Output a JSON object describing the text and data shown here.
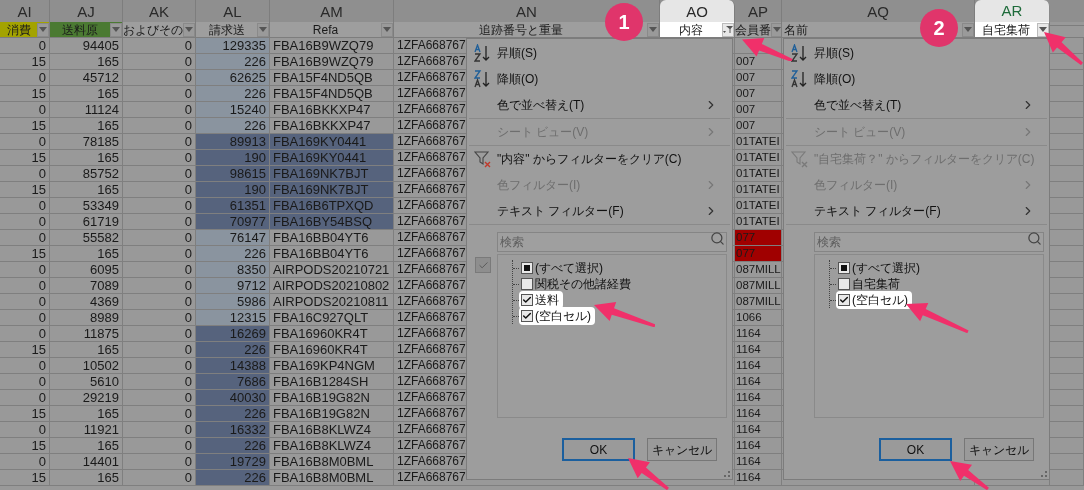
{
  "columns": [
    {
      "letter": "AI",
      "label": "消費",
      "color": "#a3a300",
      "selected": false,
      "spotlighted": false,
      "filtered": false
    },
    {
      "letter": "AJ",
      "label": "送料原",
      "color": "#4b7a32",
      "selected": false,
      "spotlighted": false,
      "filtered": false
    },
    {
      "letter": "AK",
      "label": "およびその",
      "selected": false,
      "spotlighted": false,
      "filtered": false
    },
    {
      "letter": "AL",
      "label": "請求送",
      "selected": false,
      "spotlighted": false,
      "filtered": false
    },
    {
      "letter": "AM",
      "label": "Refa",
      "selected": false,
      "spotlighted": false,
      "filtered": false
    },
    {
      "letter": "AN",
      "label": "追跡番号と重量",
      "selected": false,
      "spotlighted": false,
      "filtered": false
    },
    {
      "letter": "AO",
      "label": "内容",
      "selected": false,
      "spotlighted": true,
      "filtered": true
    },
    {
      "letter": "AP",
      "label": "会員番",
      "selected": false,
      "spotlighted": false,
      "filtered": false
    },
    {
      "letter": "AQ",
      "label": "名前",
      "selected": false,
      "spotlighted": false,
      "filtered": false
    },
    {
      "letter": "AR",
      "label": "自宅集荷",
      "selected": true,
      "spotlighted": true,
      "filtered": false
    }
  ],
  "rows": [
    {
      "cells": [
        "0",
        "94405",
        "0",
        "129335",
        "FBA16B9WZQ79",
        "1ZFA668767"
      ],
      "kind": "plain"
    },
    {
      "cells": [
        "15",
        "165",
        "0",
        "226",
        "FBA16B9WZQ79",
        "1ZFA668767",
        "007"
      ],
      "kind": "plain"
    },
    {
      "cells": [
        "0",
        "45712",
        "0",
        "62625",
        "FBA15F4ND5QB",
        "1ZFA668767",
        "007"
      ],
      "kind": "plain"
    },
    {
      "cells": [
        "15",
        "165",
        "0",
        "226",
        "FBA15F4ND5QB",
        "1ZFA668767",
        "007"
      ],
      "kind": "plain"
    },
    {
      "cells": [
        "0",
        "11124",
        "0",
        "15240",
        "FBA16BKKXP47",
        "1ZFA668767",
        "007"
      ],
      "kind": "plain"
    },
    {
      "cells": [
        "15",
        "165",
        "0",
        "226",
        "FBA16BKKXP47",
        "1ZFA668767",
        "007"
      ],
      "kind": "plain"
    },
    {
      "cells": [
        "0",
        "78185",
        "0",
        "89913",
        "FBA169KY0441",
        "1ZFA668767",
        "01TATEI"
      ],
      "kind": "band_wide"
    },
    {
      "cells": [
        "15",
        "165",
        "0",
        "190",
        "FBA169KY0441",
        "1ZFA668767",
        "01TATEI"
      ],
      "kind": "band_wide"
    },
    {
      "cells": [
        "0",
        "85752",
        "0",
        "98615",
        "FBA169NK7BJT",
        "1ZFA668767",
        "01TATEI"
      ],
      "kind": "band_wide"
    },
    {
      "cells": [
        "15",
        "165",
        "0",
        "190",
        "FBA169NK7BJT",
        "1ZFA668767",
        "01TATEI"
      ],
      "kind": "band_wide"
    },
    {
      "cells": [
        "0",
        "53349",
        "0",
        "61351",
        "FBA16B6TPXQD",
        "1ZFA668767",
        "01TATEI"
      ],
      "kind": "band_wide"
    },
    {
      "cells": [
        "0",
        "61719",
        "0",
        "70977",
        "FBA16BY54BSQ",
        "1ZFA668767",
        "01TATEI"
      ],
      "kind": "band_wide"
    },
    {
      "cells": [
        "0",
        "55582",
        "0",
        "76147",
        "FBA16BB04YT6",
        "1ZFA668767",
        "077"
      ],
      "kind": "plain",
      "color": "#a00000"
    },
    {
      "cells": [
        "15",
        "165",
        "0",
        "226",
        "FBA16BB04YT6",
        "1ZFA668767",
        "077"
      ],
      "kind": "plain",
      "color": "#a00000"
    },
    {
      "cells": [
        "0",
        "6095",
        "0",
        "8350",
        "AIRPODS20210721",
        "1ZFA668767",
        "087MILL"
      ],
      "kind": "plain"
    },
    {
      "cells": [
        "0",
        "7089",
        "0",
        "9712",
        "AIRPODS20210802",
        "1ZFA668767",
        "087MILL"
      ],
      "kind": "plain"
    },
    {
      "cells": [
        "0",
        "4369",
        "0",
        "5986",
        "AIRPODS20210811",
        "1ZFA668767",
        "087MILL"
      ],
      "kind": "plain"
    },
    {
      "cells": [
        "0",
        "8989",
        "0",
        "12315",
        "FBA16C927QLT",
        "1ZFA668767",
        "1066"
      ],
      "kind": "plain"
    },
    {
      "cells": [
        "0",
        "11875",
        "0",
        "16269",
        "FBA16960KR4T",
        "1ZFA668767",
        "1164"
      ],
      "kind": "band_narrow"
    },
    {
      "cells": [
        "15",
        "165",
        "0",
        "226",
        "FBA16960KR4T",
        "1ZFA668767",
        "1164"
      ],
      "kind": "band_narrow"
    },
    {
      "cells": [
        "0",
        "10502",
        "0",
        "14388",
        "FBA169KP4NGM",
        "1ZFA668767",
        "1164"
      ],
      "kind": "band_narrow"
    },
    {
      "cells": [
        "0",
        "5610",
        "0",
        "7686",
        "FBA16B1284SH",
        "1ZFA668767",
        "1164"
      ],
      "kind": "band_narrow"
    },
    {
      "cells": [
        "0",
        "29219",
        "0",
        "40030",
        "FBA16B19G82N",
        "1ZFA668767",
        "1164"
      ],
      "kind": "band_narrow"
    },
    {
      "cells": [
        "15",
        "165",
        "0",
        "226",
        "FBA16B19G82N",
        "1ZFA668767",
        "1164"
      ],
      "kind": "band_narrow"
    },
    {
      "cells": [
        "0",
        "11921",
        "0",
        "16332",
        "FBA16B8KLWZ4",
        "1ZFA668767",
        "1164"
      ],
      "kind": "band_narrow"
    },
    {
      "cells": [
        "15",
        "165",
        "0",
        "226",
        "FBA16B8KLWZ4",
        "1ZFA668767",
        "1164"
      ],
      "kind": "band_narrow"
    },
    {
      "cells": [
        "0",
        "14401",
        "0",
        "19729",
        "FBA16B8M0BML",
        "1ZFA668767",
        "1164"
      ],
      "kind": "band_narrow"
    },
    {
      "cells": [
        "15",
        "165",
        "0",
        "226",
        "FBA16B8M0BML",
        "1ZFA668767",
        "1164"
      ],
      "kind": "band_narrow"
    }
  ],
  "filter_menus": [
    {
      "side_check": true,
      "items": [
        {
          "kind": "sort_asc",
          "label": "昇順(S)",
          "disabled": false
        },
        {
          "kind": "sort_desc",
          "label": "降順(O)",
          "disabled": false
        },
        {
          "kind": "submenu",
          "label": "色で並べ替え(T)",
          "disabled": false
        },
        {
          "kind": "submenu",
          "label": "シート ビュー(V)",
          "disabled": true
        },
        {
          "kind": "clear",
          "label": "\"内容\" からフィルターをクリア(C)",
          "disabled": false
        },
        {
          "kind": "submenu",
          "label": "色フィルター(I)",
          "disabled": true
        },
        {
          "kind": "submenu",
          "label": "テキスト フィルター(F)",
          "disabled": false
        }
      ],
      "search": {
        "placeholder": "検索"
      },
      "options": [
        {
          "label": "(すべて選択)",
          "checked": true,
          "indeterminate": true,
          "spotlighted": false
        },
        {
          "label": "関税その他諸経費",
          "checked": false,
          "indeterminate": false,
          "spotlighted": false
        },
        {
          "label": "送料",
          "checked": true,
          "indeterminate": false,
          "spotlighted": true
        },
        {
          "label": "(空白セル)",
          "checked": true,
          "indeterminate": false,
          "spotlighted": true
        }
      ],
      "buttons": [
        {
          "label": "OK",
          "focused": true
        },
        {
          "label": "キャンセル",
          "focused": false
        }
      ]
    },
    {
      "side_check": false,
      "items": [
        {
          "kind": "sort_asc",
          "label": "昇順(S)",
          "disabled": false
        },
        {
          "kind": "sort_desc",
          "label": "降順(O)",
          "disabled": false
        },
        {
          "kind": "submenu",
          "label": "色で並べ替え(T)",
          "disabled": false
        },
        {
          "kind": "submenu",
          "label": "シート ビュー(V)",
          "disabled": true
        },
        {
          "kind": "clear",
          "label": "\"自宅集荷？\" からフィルターをクリア(C)",
          "disabled": true
        },
        {
          "kind": "submenu",
          "label": "色フィルター(I)",
          "disabled": true
        },
        {
          "kind": "submenu",
          "label": "テキスト フィルター(F)",
          "disabled": false
        }
      ],
      "search": {
        "placeholder": "検索"
      },
      "options": [
        {
          "label": "(すべて選択)",
          "checked": true,
          "indeterminate": true,
          "spotlighted": false
        },
        {
          "label": "自宅集荷",
          "checked": false,
          "indeterminate": false,
          "spotlighted": false
        },
        {
          "label": "(空白セル)",
          "checked": true,
          "indeterminate": false,
          "spotlighted": true
        }
      ],
      "buttons": [
        {
          "label": "OK",
          "focused": true
        },
        {
          "label": "キャンセル",
          "focused": false
        }
      ]
    }
  ],
  "annotations": [
    {
      "label": "1"
    },
    {
      "label": "2"
    }
  ]
}
